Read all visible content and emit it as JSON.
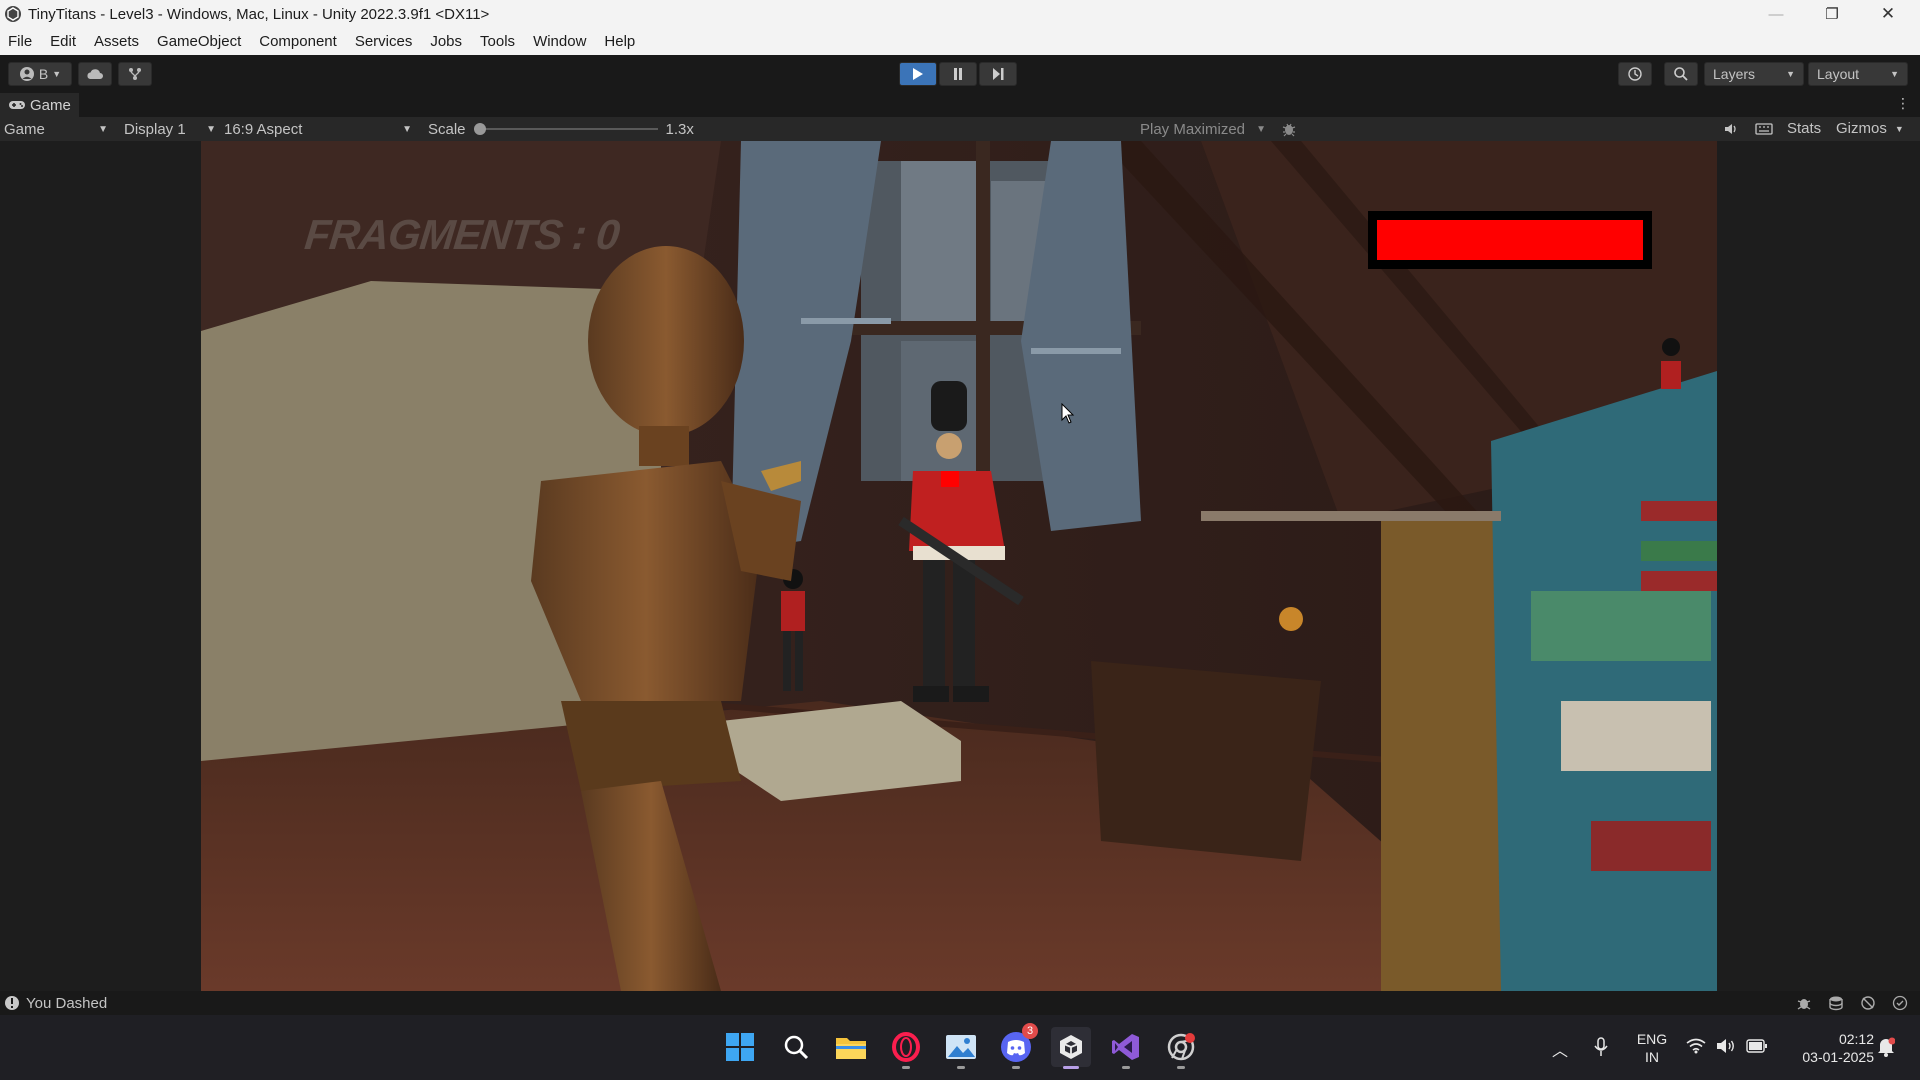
{
  "window": {
    "title": "TinyTitans - Level3 - Windows, Mac, Linux - Unity 2022.3.9f1 <DX11>",
    "minimize_glyph": "—",
    "restore_glyph": "❐",
    "close_glyph": "✕"
  },
  "menu": {
    "items": [
      "File",
      "Edit",
      "Assets",
      "GameObject",
      "Component",
      "Services",
      "Jobs",
      "Tools",
      "Window",
      "Help"
    ]
  },
  "toolbar": {
    "account_label": "B",
    "layers_label": "Layers",
    "layout_label": "Layout",
    "play_icon": "play-icon",
    "pause_icon": "pause-icon",
    "step_icon": "step-icon"
  },
  "panel": {
    "tab_label": "Game",
    "view_mode": "Game",
    "display": "Display 1",
    "aspect": "16:9 Aspect",
    "scale_label": "Scale",
    "scale_value": "1.3x",
    "scale_fraction": 0.0,
    "play_mode": "Play Maximized",
    "stats_label": "Stats",
    "gizmos_label": "Gizmos"
  },
  "game_hud": {
    "fragments_text": "FRAGMENTS : 0",
    "health_fraction": 1.0,
    "health_color": "#ff0000"
  },
  "status": {
    "message": "You Dashed"
  },
  "taskbar": {
    "apps": [
      "windows-start",
      "search",
      "file-explorer",
      "opera-gx",
      "photos",
      "discord",
      "unity",
      "visual-studio",
      "chrome-canary"
    ],
    "discord_badge": "3",
    "language": "ENG",
    "region": "IN",
    "time": "02:12",
    "date": "03-01-2025"
  },
  "colors": {
    "editor_bg": "#191919",
    "panel_bg": "#282828",
    "accent_play": "#3b74b8"
  }
}
